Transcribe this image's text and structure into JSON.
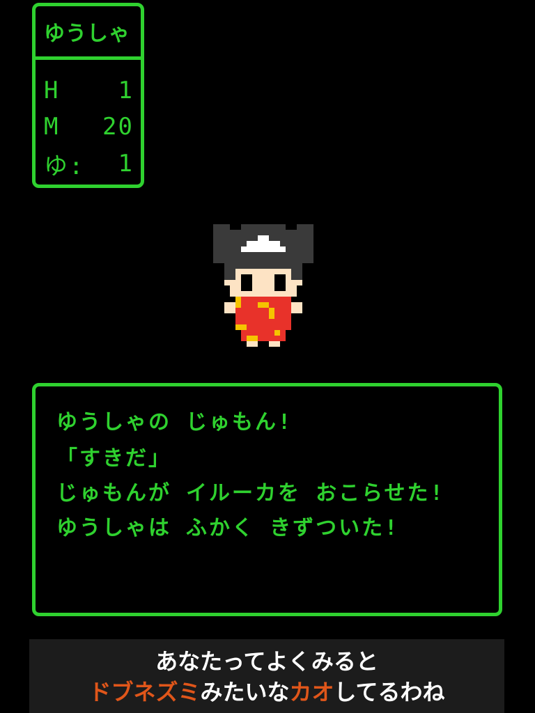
{
  "status": {
    "name": "ゆうしゃ",
    "rows": [
      {
        "label": "H",
        "value": "1"
      },
      {
        "label": "M",
        "value": "20"
      },
      {
        "label": "ゆ:",
        "value": "1"
      }
    ]
  },
  "sprite": {
    "icon": "hero-girl-sprite",
    "colors": {
      "hair": "#3a3a3a",
      "skin": "#fde3c4",
      "dress": "#e8322a",
      "accent": "#f5c400",
      "outline": "#000000"
    }
  },
  "message": {
    "lines": [
      "ゆうしゃの じゅもん!",
      "「すきだ」",
      "じゅもんが イルーカを おこらせた!",
      "ゆうしゃは ふかく きずついた!"
    ]
  },
  "caption": {
    "line1": "あなたってよくみると",
    "line2_orange_1": "ドブネズミ",
    "line2_white_1": "みたいな",
    "line2_orange_2": "カオ",
    "line2_white_2": "してるわね"
  },
  "colors": {
    "window_border": "#2fd12f",
    "text_green": "#2fd12f",
    "caption_orange": "#e0561a",
    "caption_bg": "#1c1c1c"
  }
}
